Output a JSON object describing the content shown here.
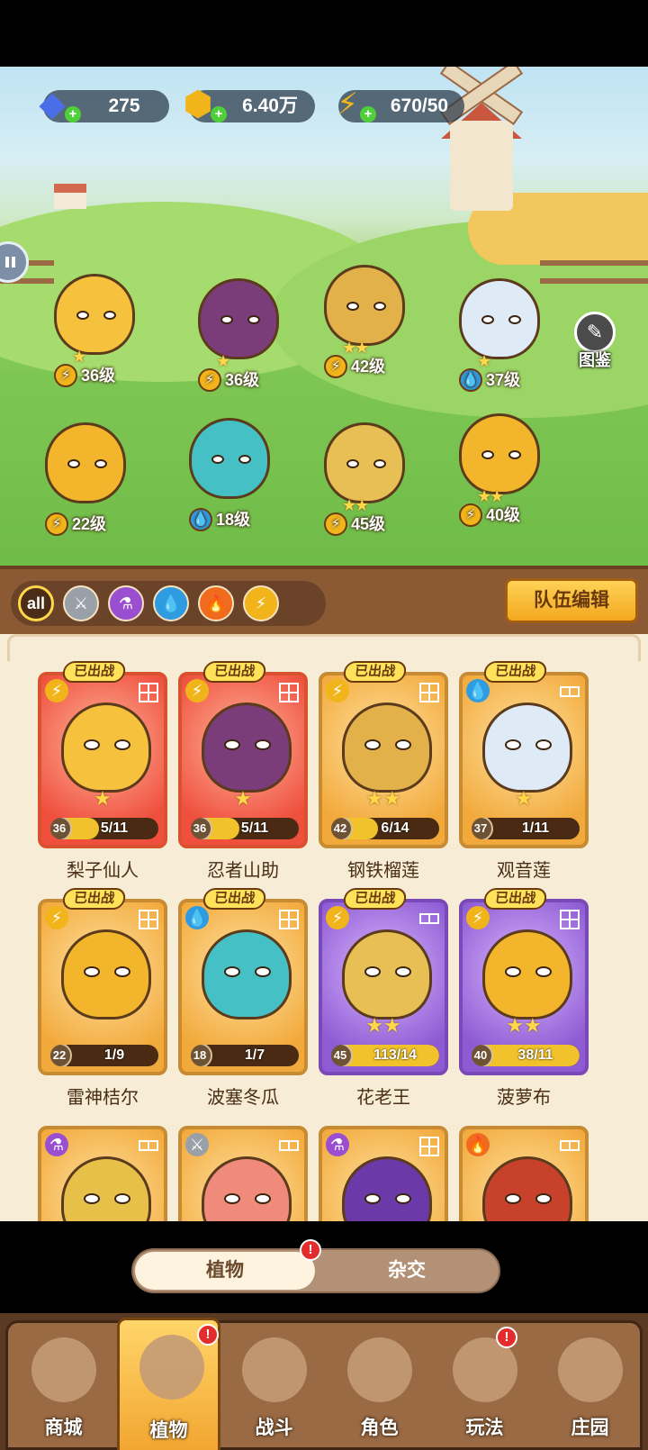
{
  "resources": {
    "gems": "275",
    "coins": "6.40万",
    "energy": "670/50"
  },
  "guide_label": "图鉴",
  "field_heroes": [
    {
      "level": "36级",
      "element": "lightning",
      "stars": "★",
      "color": "#f6c13c"
    },
    {
      "level": "36级",
      "element": "lightning",
      "stars": "★",
      "color": "#7b3c7a"
    },
    {
      "level": "42级",
      "element": "lightning",
      "stars": "★★",
      "color": "#e2b14a"
    },
    {
      "level": "37级",
      "element": "water",
      "stars": "★",
      "color": "#dfeaf7"
    },
    {
      "level": "22级",
      "element": "lightning",
      "stars": "",
      "color": "#f3b52b"
    },
    {
      "level": "18级",
      "element": "water",
      "stars": "",
      "color": "#45c0c4"
    },
    {
      "level": "45级",
      "element": "lightning",
      "stars": "★★",
      "color": "#e7bf55"
    },
    {
      "level": "40级",
      "element": "lightning",
      "stars": "★★",
      "color": "#f3b52b"
    }
  ],
  "filters": [
    {
      "label": "all",
      "icon": "all-icon",
      "color": "#4b2c17"
    },
    {
      "label": "",
      "icon": "sword-icon",
      "color": "#9aa0a8"
    },
    {
      "label": "",
      "icon": "potion-icon",
      "color": "#9a4fd0"
    },
    {
      "label": "",
      "icon": "water-icon",
      "color": "#2f9be0"
    },
    {
      "label": "",
      "icon": "fire-icon",
      "color": "#f16b1f"
    },
    {
      "label": "",
      "icon": "lightning-icon",
      "color": "#f1b51b"
    }
  ],
  "team_button": "队伍编辑",
  "deployed_label": "已出战",
  "plants": [
    {
      "name": "梨子仙人",
      "level": "36",
      "fragments": "5/11",
      "progress": 0.45,
      "stars": "★",
      "theme": "red",
      "element": "lightning",
      "slots": "grid",
      "art": "#f6c13c"
    },
    {
      "name": "忍者山助",
      "level": "36",
      "fragments": "5/11",
      "progress": 0.45,
      "stars": "★",
      "theme": "red",
      "element": "lightning",
      "slots": "grid",
      "art": "#7b3c7a"
    },
    {
      "name": "钢铁榴莲",
      "level": "42",
      "fragments": "6/14",
      "progress": 0.43,
      "stars": "★★",
      "theme": "gold",
      "element": "lightning",
      "slots": "grid",
      "art": "#e2b14a"
    },
    {
      "name": "观音莲",
      "level": "37",
      "fragments": "1/11",
      "progress": 0.09,
      "stars": "★",
      "theme": "gold",
      "element": "water",
      "slots": "two",
      "art": "#dfeaf7"
    },
    {
      "name": "雷神桔尔",
      "level": "22",
      "fragments": "1/9",
      "progress": 0.11,
      "stars": "",
      "theme": "gold",
      "element": "lightning",
      "slots": "grid",
      "art": "#f3b52b"
    },
    {
      "name": "波塞冬瓜",
      "level": "18",
      "fragments": "1/7",
      "progress": 0.14,
      "stars": "",
      "theme": "gold",
      "element": "water",
      "slots": "grid",
      "art": "#45c0c4"
    },
    {
      "name": "花老王",
      "level": "45",
      "fragments": "113/14",
      "progress": 1,
      "stars": "★★",
      "theme": "purple",
      "element": "lightning",
      "slots": "two",
      "art": "#e7bf55"
    },
    {
      "name": "菠萝布",
      "level": "40",
      "fragments": "38/11",
      "progress": 1,
      "stars": "★★",
      "theme": "purple",
      "element": "lightning",
      "slots": "grid",
      "art": "#f3b52b"
    },
    {
      "name": "",
      "level": "",
      "fragments": "",
      "progress": 0,
      "stars": "",
      "theme": "gold",
      "element": "potion",
      "slots": "two",
      "art": "#e7c04a"
    },
    {
      "name": "",
      "level": "",
      "fragments": "",
      "progress": 0,
      "stars": "",
      "theme": "gold",
      "element": "sword",
      "slots": "two",
      "art": "#f08a7b"
    },
    {
      "name": "",
      "level": "",
      "fragments": "",
      "progress": 0,
      "stars": "",
      "theme": "gold",
      "element": "potion",
      "slots": "grid",
      "art": "#6b3aa8"
    },
    {
      "name": "",
      "level": "",
      "fragments": "",
      "progress": 0,
      "stars": "",
      "theme": "gold",
      "element": "fire",
      "slots": "two",
      "art": "#c8412b"
    }
  ],
  "toggle": {
    "left": "植物",
    "right": "杂交"
  },
  "nav": [
    {
      "label": "商城",
      "icon": "shop-icon",
      "alert": false
    },
    {
      "label": "植物",
      "icon": "plants-icon",
      "alert": true,
      "active": true
    },
    {
      "label": "战斗",
      "icon": "battle-icon",
      "alert": false
    },
    {
      "label": "角色",
      "icon": "character-icon",
      "alert": false
    },
    {
      "label": "玩法",
      "icon": "gameplay-icon",
      "alert": true
    },
    {
      "label": "庄园",
      "icon": "manor-icon",
      "alert": false
    }
  ],
  "colors": {
    "element_lightning": "#f1b51b",
    "element_water": "#2f9be0",
    "element_fire": "#f16b1f",
    "element_potion": "#9a4fd0",
    "element_sword": "#9aa0a8"
  },
  "glyphs": {
    "lightning": "⚡",
    "water": "💧",
    "fire": "🔥",
    "potion": "⚗",
    "sword": "⚔",
    "plus": "+",
    "alert": "!",
    "gem": "◆",
    "coin": "⬢"
  }
}
